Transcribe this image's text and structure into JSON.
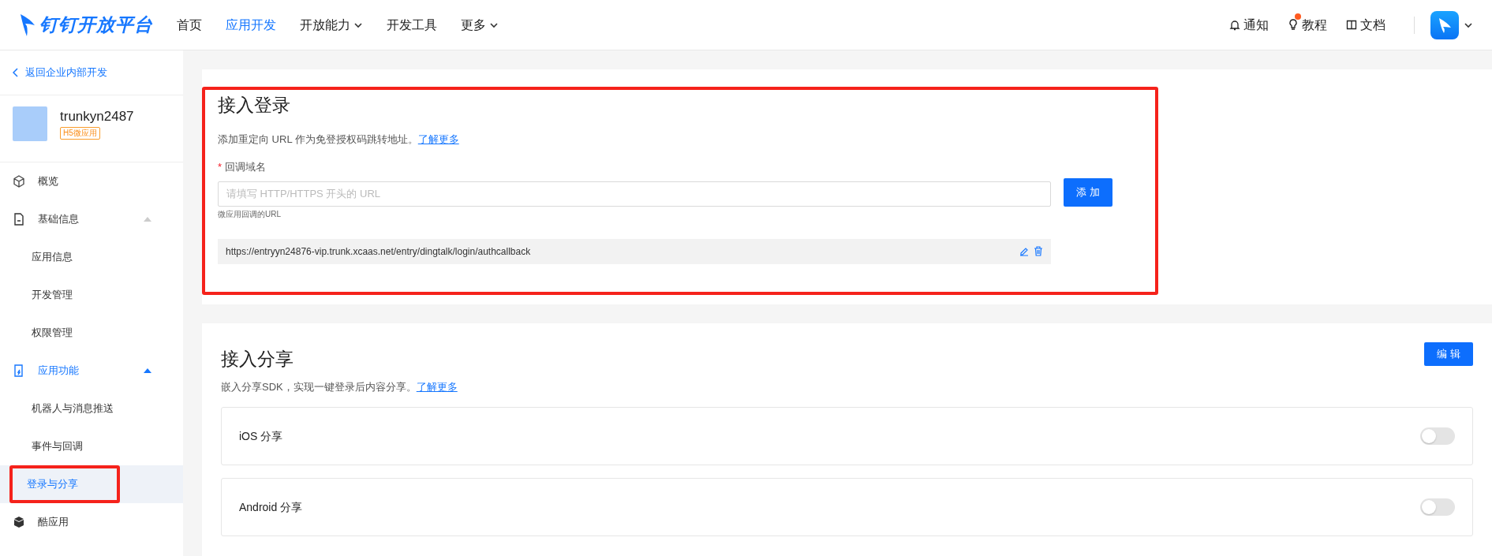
{
  "header": {
    "logo": "钉钉开放平台",
    "nav": [
      {
        "label": "首页",
        "selected": false,
        "dropdown": false
      },
      {
        "label": "应用开发",
        "selected": true,
        "dropdown": false
      },
      {
        "label": "开放能力",
        "selected": false,
        "dropdown": true
      },
      {
        "label": "开发工具",
        "selected": false,
        "dropdown": false
      },
      {
        "label": "更多",
        "selected": false,
        "dropdown": true
      }
    ],
    "links": [
      {
        "label": "通知",
        "kind": "bell",
        "dot": false
      },
      {
        "label": "教程",
        "kind": "bulb",
        "dot": true
      },
      {
        "label": "文档",
        "kind": "book",
        "dot": false
      }
    ]
  },
  "sidebar": {
    "back": "返回企业内部开发",
    "app": {
      "name": "trunkyn2487",
      "tag": "H5微应用"
    },
    "items": [
      {
        "label": "概览",
        "selected": false
      },
      {
        "label": "基础信息",
        "expanded": true,
        "children": [
          {
            "label": "应用信息",
            "selected": false,
            "highlighted": false
          },
          {
            "label": "开发管理",
            "selected": false,
            "highlighted": false
          },
          {
            "label": "权限管理",
            "selected": false,
            "highlighted": false
          }
        ]
      },
      {
        "label": "应用功能",
        "expanded": true,
        "children": [
          {
            "label": "机器人与消息推送",
            "selected": false,
            "highlighted": false
          },
          {
            "label": "事件与回调",
            "selected": false,
            "highlighted": false
          },
          {
            "label": "登录与分享",
            "selected": true,
            "highlighted": true
          }
        ]
      },
      {
        "label": "酷应用",
        "selected": false
      }
    ]
  },
  "login": {
    "title": "接入登录",
    "highlighted": true,
    "description": "添加重定向 URL 作为免登授权码跳转地址。",
    "learn_more": "了解更多",
    "field": {
      "label": "回调域名",
      "required_mark": "*",
      "placeholder": "请填写 HTTP/HTTPS 开头的 URL",
      "help": "微应用回调的URL"
    },
    "add_button": "添 加",
    "urls": [
      "https://entryyn24876-vip.trunk.xcaas.net/entry/dingtalk/login/authcallback"
    ]
  },
  "share": {
    "title": "接入分享",
    "edit_button": "编 辑",
    "description": "嵌入分享SDK，实现一键登录后内容分享。",
    "learn_more": "了解更多",
    "toggles": [
      {
        "label": "iOS 分享",
        "on": false
      },
      {
        "label": "Android 分享",
        "on": false
      }
    ]
  }
}
